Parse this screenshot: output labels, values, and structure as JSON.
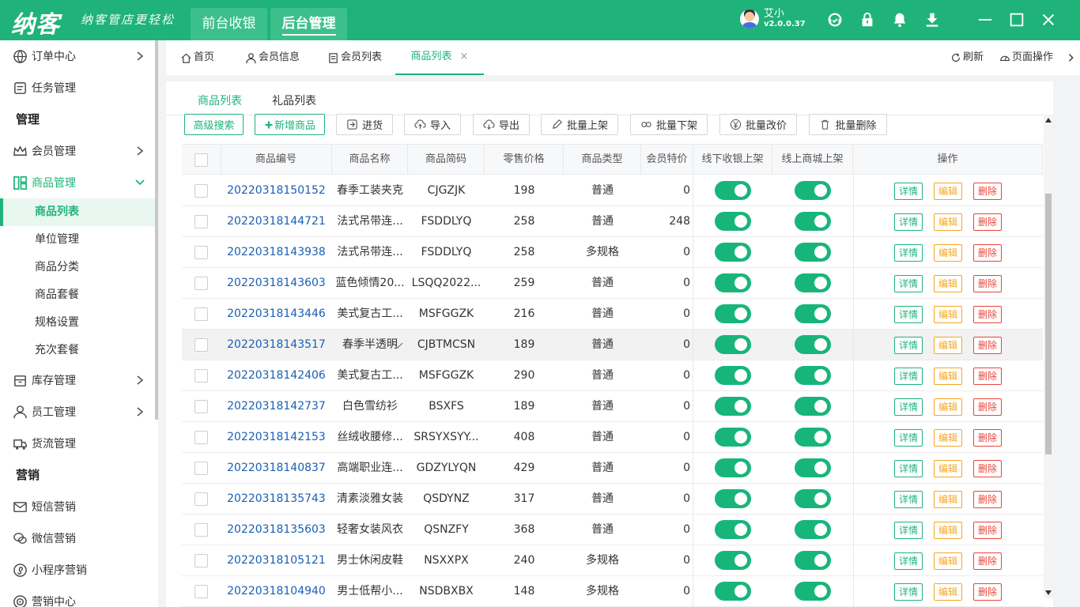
{
  "app": {
    "logo": "纳客",
    "slogan": "纳客管店更轻松",
    "nav": [
      {
        "label": "前台收银"
      },
      {
        "label": "后台管理"
      }
    ],
    "user": {
      "name": "艾小",
      "version": "v2.0.0.37"
    }
  },
  "sidebar": {
    "items": [
      {
        "type": "grp",
        "label": "订单中心",
        "icon": "globe-icon",
        "arrow": "right"
      },
      {
        "type": "grp",
        "label": "任务管理",
        "icon": "task-icon"
      },
      {
        "type": "sect",
        "label": "管理"
      },
      {
        "type": "grp",
        "label": "会员管理",
        "icon": "crown-icon",
        "arrow": "right"
      },
      {
        "type": "grp",
        "label": "商品管理",
        "icon": "grid-icon",
        "arrow": "down",
        "open": true
      },
      {
        "type": "sub",
        "label": "商品列表",
        "active": true
      },
      {
        "type": "sub",
        "label": "单位管理"
      },
      {
        "type": "sub",
        "label": "商品分类"
      },
      {
        "type": "sub",
        "label": "商品套餐"
      },
      {
        "type": "sub",
        "label": "规格设置"
      },
      {
        "type": "sub",
        "label": "充次套餐"
      },
      {
        "type": "grp",
        "label": "库存管理",
        "icon": "box-icon",
        "arrow": "right"
      },
      {
        "type": "grp",
        "label": "员工管理",
        "icon": "person-icon",
        "arrow": "right"
      },
      {
        "type": "grp",
        "label": "货流管理",
        "icon": "truck-icon"
      },
      {
        "type": "sect",
        "label": "营销"
      },
      {
        "type": "grp",
        "label": "短信营销",
        "icon": "mail-icon"
      },
      {
        "type": "grp",
        "label": "微信营销",
        "icon": "wechat-icon"
      },
      {
        "type": "grp",
        "label": "小程序营销",
        "icon": "miniapp-icon"
      },
      {
        "type": "grp",
        "label": "营销中心",
        "icon": "target-icon"
      }
    ]
  },
  "tabs": [
    {
      "label": "首页",
      "icon": "home-icon"
    },
    {
      "label": "会员信息",
      "icon": "user-icon"
    },
    {
      "label": "会员列表",
      "icon": "list-icon"
    },
    {
      "label": "商品列表",
      "active": true,
      "close": "×"
    }
  ],
  "tools": {
    "refresh": "刷新",
    "page_ops": "页面操作"
  },
  "subtabs": [
    {
      "label": "商品列表",
      "active": true
    },
    {
      "label": "礼品列表"
    }
  ],
  "toolbar": {
    "advanced_search": "高级搜索",
    "add_product": "新增商品",
    "stock_in": "进货",
    "import": "导入",
    "export": "导出",
    "batch_on": "批量上架",
    "batch_off": "批量下架",
    "batch_price": "批量改价",
    "batch_delete": "批量删除"
  },
  "table": {
    "headers": [
      "商品编号",
      "商品名称",
      "商品简码",
      "零售价格",
      "商品类型",
      "会员特价",
      "线下收银上架",
      "线上商城上架",
      "操作"
    ],
    "actions": {
      "detail": "详情",
      "edit": "编辑",
      "delete": "删除"
    },
    "rows": [
      {
        "code": "20220318150152",
        "name": "春季工装夹克",
        "short": "CJGZJK",
        "price": "198",
        "type": "普通",
        "member": "0"
      },
      {
        "code": "20220318144721",
        "name": "法式吊带连...",
        "short": "FSDDLYQ",
        "price": "258",
        "type": "普通",
        "member": "248"
      },
      {
        "code": "20220318143938",
        "name": "法式吊带连...",
        "short": "FSDDLYQ",
        "price": "258",
        "type": "多规格",
        "member": "0"
      },
      {
        "code": "20220318143603",
        "name": "蓝色倾情20...",
        "short": "LSQQ2022...",
        "price": "259",
        "type": "普通",
        "member": "0"
      },
      {
        "code": "20220318143446",
        "name": "美式复古工...",
        "short": "MSFGGZK",
        "price": "216",
        "type": "普通",
        "member": "0"
      },
      {
        "code": "20220318143517",
        "name": "春季半透明",
        "short": "CJBTMCSN",
        "price": "189",
        "type": "普通",
        "member": "0",
        "hl": true
      },
      {
        "code": "20220318142406",
        "name": "美式复古工...",
        "short": "MSFGGZK",
        "price": "290",
        "type": "普通",
        "member": "0"
      },
      {
        "code": "20220318142737",
        "name": "白色雪纺衫",
        "short": "BSXFS",
        "price": "189",
        "type": "普通",
        "member": "0"
      },
      {
        "code": "20220318142153",
        "name": "丝绒收腰修...",
        "short": "SRSYXSYY...",
        "price": "408",
        "type": "普通",
        "member": "0"
      },
      {
        "code": "20220318140837",
        "name": "高端职业连...",
        "short": "GDZYLYQN",
        "price": "429",
        "type": "普通",
        "member": "0"
      },
      {
        "code": "20220318135743",
        "name": "清素淡雅女装",
        "short": "QSDYNZ",
        "price": "317",
        "type": "普通",
        "member": "0"
      },
      {
        "code": "20220318135603",
        "name": "轻奢女装风衣",
        "short": "QSNZFY",
        "price": "368",
        "type": "普通",
        "member": "0"
      },
      {
        "code": "20220318105121",
        "name": "男士休闲皮鞋",
        "short": "NSXXPX",
        "price": "240",
        "type": "多规格",
        "member": "0"
      },
      {
        "code": "20220318104940",
        "name": "男士低帮小...",
        "short": "NSDBXBX",
        "price": "148",
        "type": "多规格",
        "member": "0"
      }
    ]
  }
}
